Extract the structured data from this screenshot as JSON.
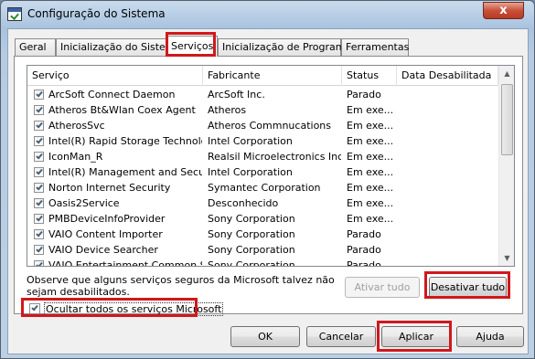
{
  "window": {
    "title": "Configuração do Sistema",
    "close_glyph": "x"
  },
  "tabs": [
    {
      "label": "Geral"
    },
    {
      "label": "Inicialização do Sistema"
    },
    {
      "label": "Serviços",
      "selected": true
    },
    {
      "label": "Inicialização de Programas"
    },
    {
      "label": "Ferramentas"
    }
  ],
  "columns": [
    "Serviço",
    "Fabricante",
    "Status",
    "Data Desabilitada"
  ],
  "services": [
    {
      "name": "ArcSoft Connect Daemon",
      "maker": "ArcSoft Inc.",
      "status": "Parado",
      "date": "",
      "checked": true
    },
    {
      "name": "Atheros Bt&Wlan Coex Agent",
      "maker": "Atheros",
      "status": "Em exe...",
      "date": "",
      "checked": true
    },
    {
      "name": "AtherosSvc",
      "maker": "Atheros Commnucations",
      "status": "Em exe...",
      "date": "",
      "checked": true
    },
    {
      "name": "Intel(R) Rapid Storage Technology",
      "maker": "Intel Corporation",
      "status": "Em exe...",
      "date": "",
      "checked": true
    },
    {
      "name": "IconMan_R",
      "maker": "Realsil Microelectronics Inc.",
      "status": "Em exe...",
      "date": "",
      "checked": true
    },
    {
      "name": "Intel(R) Management and Securi...",
      "maker": "Intel Corporation",
      "status": "Em exe...",
      "date": "",
      "checked": true
    },
    {
      "name": "Norton Internet Security",
      "maker": "Symantec Corporation",
      "status": "Em exe...",
      "date": "",
      "checked": true
    },
    {
      "name": "Oasis2Service",
      "maker": "Desconhecido",
      "status": "Em exe...",
      "date": "",
      "checked": true
    },
    {
      "name": "PMBDeviceInfoProvider",
      "maker": "Sony Corporation",
      "status": "Em exe...",
      "date": "",
      "checked": true
    },
    {
      "name": "VAIO Content Importer",
      "maker": "Sony Corporation",
      "status": "Parado",
      "date": "",
      "checked": true
    },
    {
      "name": "VAIO Device Searcher",
      "maker": "Sony Corporation",
      "status": "Parado",
      "date": "",
      "checked": true
    },
    {
      "name": "VAIO Entertainment Common Se...",
      "maker": "Sony Corporation",
      "status": "Parado",
      "date": "",
      "checked": true
    }
  ],
  "note": "Observe que alguns serviços seguros da Microsoft talvez não sejam desabilitados.",
  "buttons": {
    "enable_all": "Ativar tudo",
    "disable_all": "Desativar tudo",
    "ok": "OK",
    "cancel": "Cancelar",
    "apply": "Aplicar",
    "help": "Ajuda"
  },
  "hide_ms": {
    "label": "Ocultar todos os serviços Microsoft",
    "checked": true
  },
  "highlight_color": "#d0181c"
}
